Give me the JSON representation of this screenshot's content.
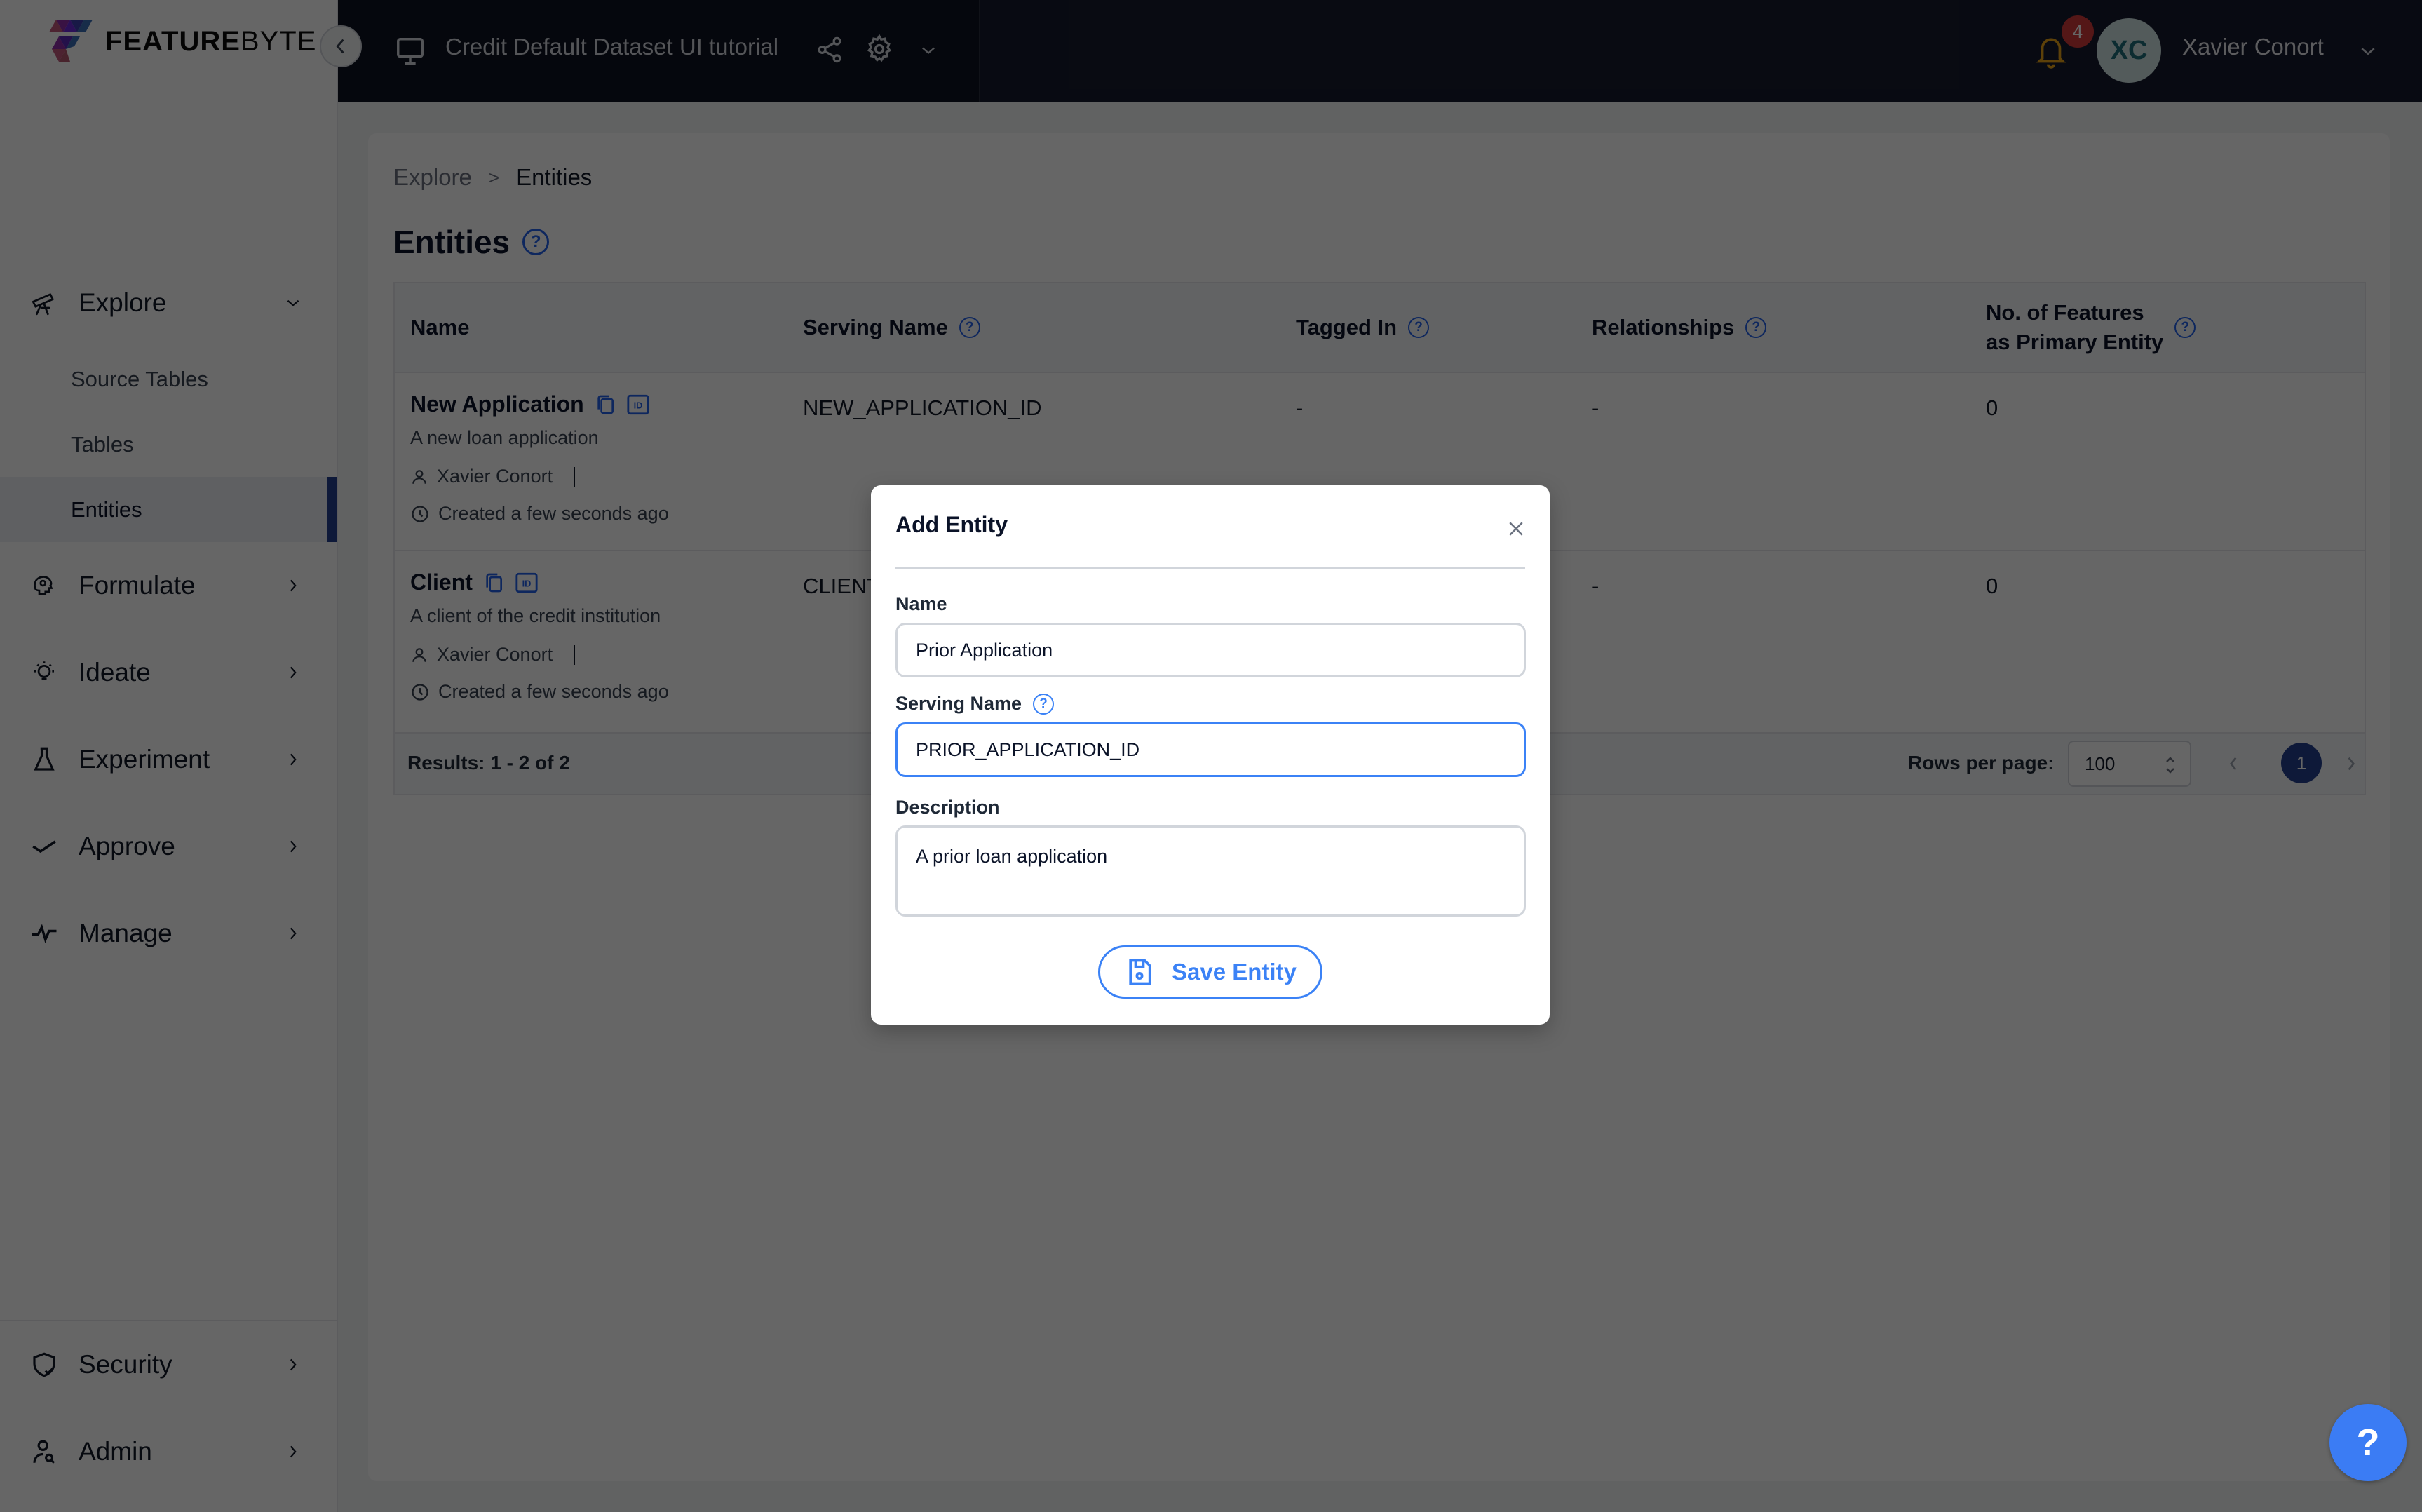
{
  "app": {
    "logo_bold": "FEATURE",
    "logo_light": "BYTE"
  },
  "topbar": {
    "catalog_title": "Credit Default Dataset UI tutorial",
    "notification_count": "4",
    "user_initials": "XC",
    "user_name": "Xavier Conort"
  },
  "sidebar": {
    "sections": [
      {
        "label": "Explore",
        "icon": "telescope-icon",
        "expanded": true,
        "children": [
          {
            "label": "Source Tables",
            "active": false
          },
          {
            "label": "Tables",
            "active": false
          },
          {
            "label": "Entities",
            "active": true
          }
        ]
      },
      {
        "label": "Formulate",
        "icon": "head-gear-icon",
        "expanded": false
      },
      {
        "label": "Ideate",
        "icon": "lightbulb-icon",
        "expanded": false
      },
      {
        "label": "Experiment",
        "icon": "flask-icon",
        "expanded": false
      },
      {
        "label": "Approve",
        "icon": "check-icon",
        "expanded": false
      },
      {
        "label": "Manage",
        "icon": "pulse-icon",
        "expanded": false
      }
    ],
    "bottom": [
      {
        "label": "Security",
        "icon": "shield-check-icon"
      },
      {
        "label": "Admin",
        "icon": "user-search-icon"
      }
    ]
  },
  "main": {
    "breadcrumb": [
      "Explore",
      "Entities"
    ],
    "breadcrumb_separator": ">",
    "title": "Entities",
    "help_glyph": "?",
    "add_entity_label": "Add Entity",
    "table": {
      "columns": [
        {
          "label": "Name",
          "help": false
        },
        {
          "label": "Serving Name",
          "help": true
        },
        {
          "label": "Tagged In",
          "help": true
        },
        {
          "label": "Relationships",
          "help": true
        },
        {
          "label": "No. of Features",
          "label2": "as Primary Entity",
          "help": true
        }
      ],
      "rows": [
        {
          "name": "New Application",
          "description": "A new loan application",
          "owner": "Xavier Conort",
          "created": "Created a few seconds ago",
          "serving_name": "NEW_APPLICATION_ID",
          "tagged_in": "-",
          "relationships": "-",
          "num_features": "0"
        },
        {
          "name": "Client",
          "description": "A client of the credit institution",
          "owner": "Xavier Conort",
          "created": "Created a few seconds ago",
          "serving_name": "CLIENT_ID",
          "tagged_in": "-",
          "relationships": "-",
          "num_features": "0"
        }
      ],
      "footer": {
        "results": "Results: 1 - 2 of 2",
        "rows_per_page_label": "Rows per page:",
        "rows_per_page_value": "100",
        "current_page": "1"
      }
    }
  },
  "modal": {
    "title": "Add Entity",
    "name_label": "Name",
    "name_value": "Prior Application",
    "serving_name_label": "Serving Name",
    "serving_name_value": "PRIOR_APPLICATION_ID",
    "description_label": "Description",
    "description_value": "A prior loan application",
    "save_label": "Save Entity"
  },
  "help_fab": "?",
  "colors": {
    "brand_navy": "#23408e",
    "accent_blue": "#3b82f6",
    "topbar_bg": "#161b2e",
    "badge_red": "#d33a3a"
  }
}
